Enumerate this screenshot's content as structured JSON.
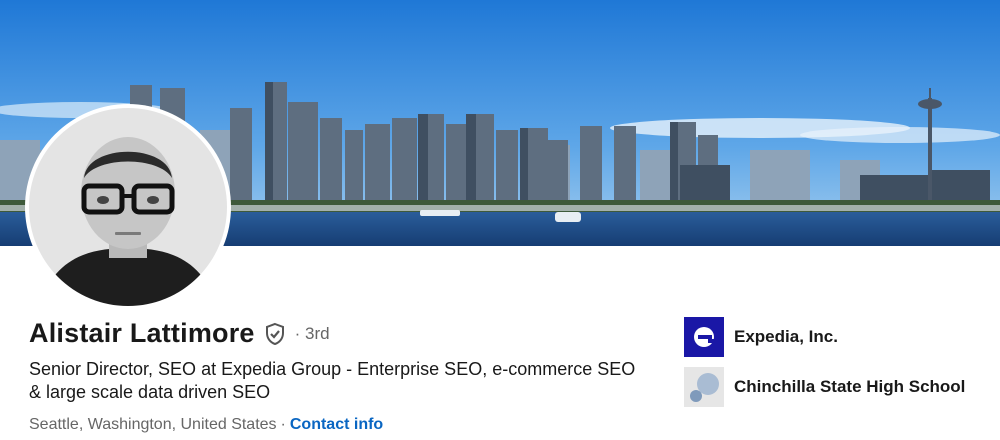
{
  "profile": {
    "name": "Alistair Lattimore",
    "degree": "· 3rd",
    "headline": "Senior Director, SEO at Expedia Group - Enterprise SEO, e-commerce SEO & large scale data driven SEO",
    "location": "Seattle, Washington, United States",
    "separator": "·",
    "contact_label": "Contact info"
  },
  "organizations": [
    {
      "label": "Expedia, Inc.",
      "icon": "expedia-logo"
    },
    {
      "label": "Chinchilla State High School",
      "icon": "school-logo"
    }
  ],
  "colors": {
    "link": "#0a66c2",
    "text": "#191919",
    "muted": "#666666",
    "expedia_brand": "#1a17a6"
  }
}
